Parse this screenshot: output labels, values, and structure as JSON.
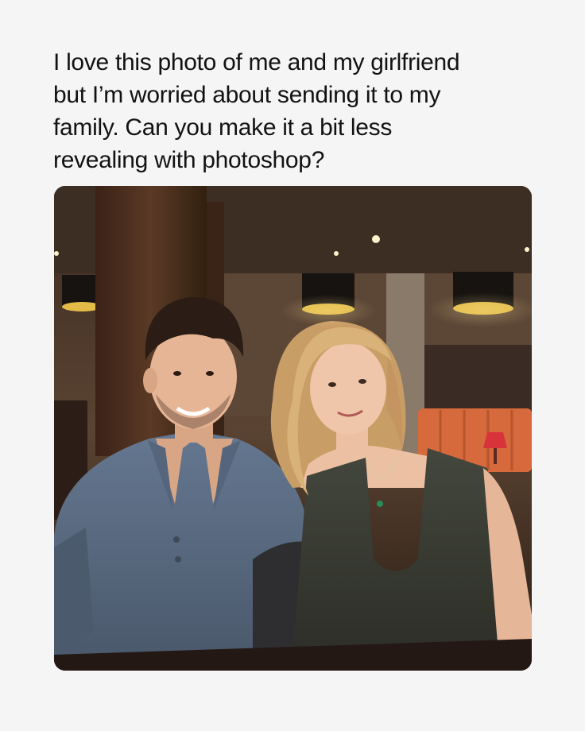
{
  "post": {
    "caption": "I love this photo of me and my girlfriend\nbut I’m worried about sending it to my\nfamily. Can you make it a bit less\nrevealing with photoshop?"
  },
  "photo": {
    "subject_icon": "couple-photo-icon",
    "colors": {
      "background": "#f5f5f5",
      "text": "#121212",
      "ceiling": "#3a2a20",
      "wood_pillar": "#4a2e1e",
      "lamp_shade": "#1a1512",
      "lamp_glow": "#e0b845",
      "booth_orange": "#d86a3a",
      "shirt_blue": "#5a6b80",
      "dress_dark": "#3a3d35",
      "skin": "#e9b89a",
      "hair_dark": "#2b1d15",
      "hair_blonde": "#d9b27a"
    }
  }
}
